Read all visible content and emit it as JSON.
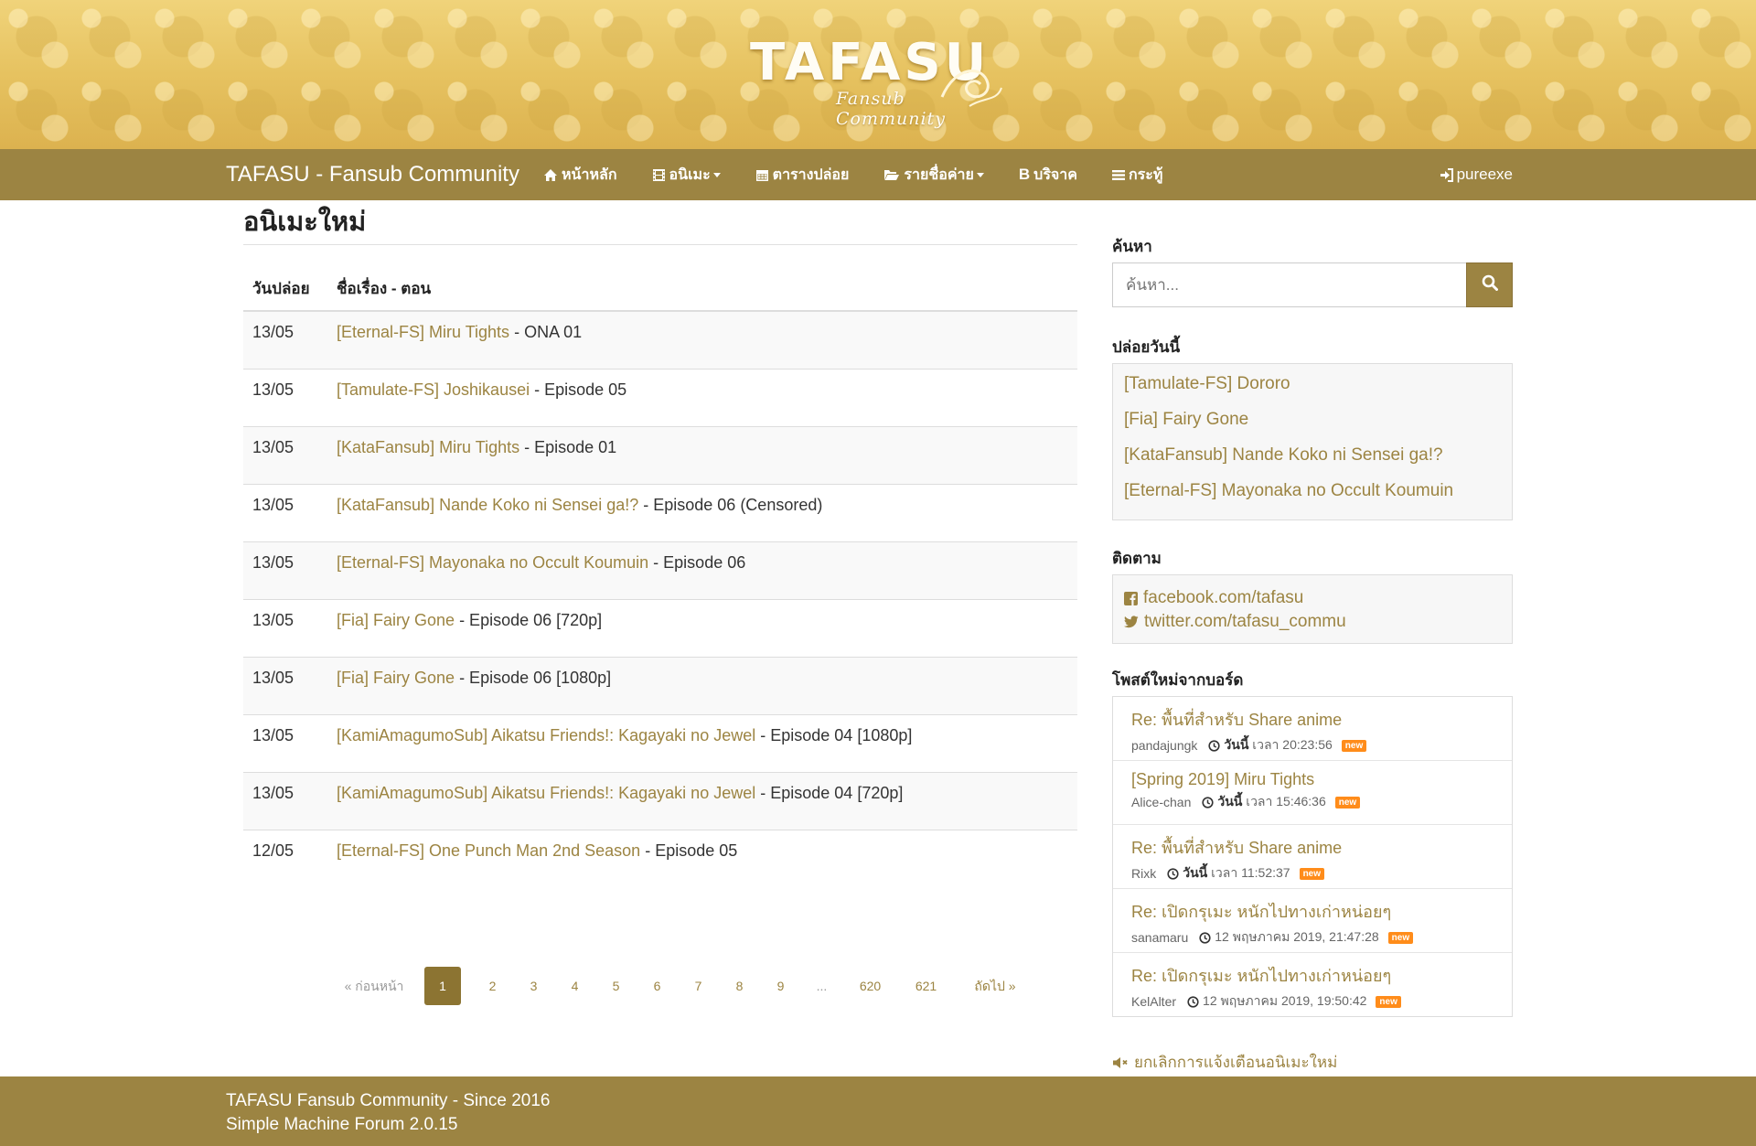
{
  "banner": {
    "logo_title": "TAFASU",
    "logo_subtitle": "Fansub Community"
  },
  "navbar": {
    "brand": "TAFASU - Fansub Community",
    "items": [
      {
        "label": "หน้าหลัก",
        "icon": "home-icon",
        "caret": false
      },
      {
        "label": "อนิเมะ",
        "icon": "film-icon",
        "caret": true
      },
      {
        "label": "ตารางปล่อย",
        "icon": "calendar-icon",
        "caret": false
      },
      {
        "label": "รายชื่อค่าย",
        "icon": "folder-open-icon",
        "caret": true
      },
      {
        "label": "บริจาค",
        "icon": "bitcoin-icon",
        "caret": false
      },
      {
        "label": "กระทู้",
        "icon": "bars-icon",
        "caret": false
      }
    ],
    "user": "pureexe"
  },
  "main": {
    "title": "อนิเมะใหม่",
    "columns": [
      "วันปล่อย",
      "ชื่อเรื่อง - ตอน"
    ],
    "rows": [
      {
        "date": "13/05",
        "title": "[Eternal-FS] Miru Tights",
        "episode": "- ONA 01"
      },
      {
        "date": "13/05",
        "title": "[Tamulate-FS] Joshikausei",
        "episode": "- Episode 05"
      },
      {
        "date": "13/05",
        "title": "[KataFansub] Miru Tights",
        "episode": "- Episode 01"
      },
      {
        "date": "13/05",
        "title": "[KataFansub] Nande Koko ni Sensei ga!?",
        "episode": "- Episode 06 (Censored)"
      },
      {
        "date": "13/05",
        "title": "[Eternal-FS] Mayonaka no Occult Koumuin",
        "episode": "- Episode 06"
      },
      {
        "date": "13/05",
        "title": "[Fia] Fairy Gone",
        "episode": "- Episode 06 [720p]"
      },
      {
        "date": "13/05",
        "title": "[Fia] Fairy Gone",
        "episode": "- Episode 06 [1080p]"
      },
      {
        "date": "13/05",
        "title": "[KamiAmagumoSub] Aikatsu Friends!: Kagayaki no Jewel",
        "episode": "- Episode 04 [1080p]"
      },
      {
        "date": "13/05",
        "title": "[KamiAmagumoSub] Aikatsu Friends!: Kagayaki no Jewel",
        "episode": "- Episode 04 [720p]"
      },
      {
        "date": "12/05",
        "title": "[Eternal-FS] One Punch Man 2nd Season",
        "episode": "- Episode 05"
      }
    ],
    "pagination": {
      "prev": "« ก่อนหน้า",
      "pages": [
        "1",
        "2",
        "3",
        "4",
        "5",
        "6",
        "7",
        "8",
        "9",
        "...",
        "620",
        "621"
      ],
      "current": "1",
      "next": "ถัดไป »"
    }
  },
  "sidebar": {
    "search_heading": "ค้นหา",
    "search_placeholder": "ค้นหา...",
    "today_heading": "ปล่อยวันนี้",
    "today": [
      "[Tamulate-FS] Dororo",
      "[Fia] Fairy Gone",
      "[KataFansub] Nande Koko ni Sensei ga!?",
      "[Eternal-FS] Mayonaka no Occult Koumuin"
    ],
    "follow_heading": "ติดตาม",
    "follow": [
      {
        "icon": "facebook-icon",
        "label": "facebook.com/tafasu"
      },
      {
        "icon": "twitter-icon",
        "label": "twitter.com/tafasu_commu"
      }
    ],
    "board_heading": "โพสต์ใหม่จากบอร์ด",
    "posts": [
      {
        "title": "Re: พื้นที่สำหรับ Share anime",
        "author": "pandajungk",
        "time": "วันนี้ เวลา 20:23:56",
        "time_bold": "วันนี้",
        "badge": "new"
      },
      {
        "title": "[Spring 2019] Miru Tights",
        "author": "Alice-chan",
        "time": "วันนี้ เวลา 15:46:36",
        "time_bold": "วันนี้",
        "badge": "new"
      },
      {
        "title": "Re: พื้นที่สำหรับ Share anime",
        "author": "Rixk",
        "time": "วันนี้ เวลา 11:52:37",
        "time_bold": "วันนี้",
        "badge": "new"
      },
      {
        "title": "Re: เปิดกรุเมะ หนักไปทางเก่าหน่อยๆ",
        "author": "sanamaru",
        "time": "12 พฤษภาคม 2019, 21:47:28",
        "time_bold": "",
        "badge": "new"
      },
      {
        "title": "Re: เปิดกรุเมะ หนักไปทางเก่าหน่อยๆ",
        "author": "KelAlter",
        "time": "12 พฤษภาคม 2019, 19:50:42",
        "time_bold": "",
        "badge": "new"
      }
    ],
    "mute_label": "ยกเลิกการแจ้งเตือนอนิเมะใหม่"
  },
  "footer": {
    "line1": "TAFASU Fansub Community - Since 2016",
    "line2": "Simple Machine Forum 2.0.15"
  },
  "colors": {
    "brand": "#9c8442",
    "badge": "#ff8c1a",
    "banner": "#e8c766"
  }
}
